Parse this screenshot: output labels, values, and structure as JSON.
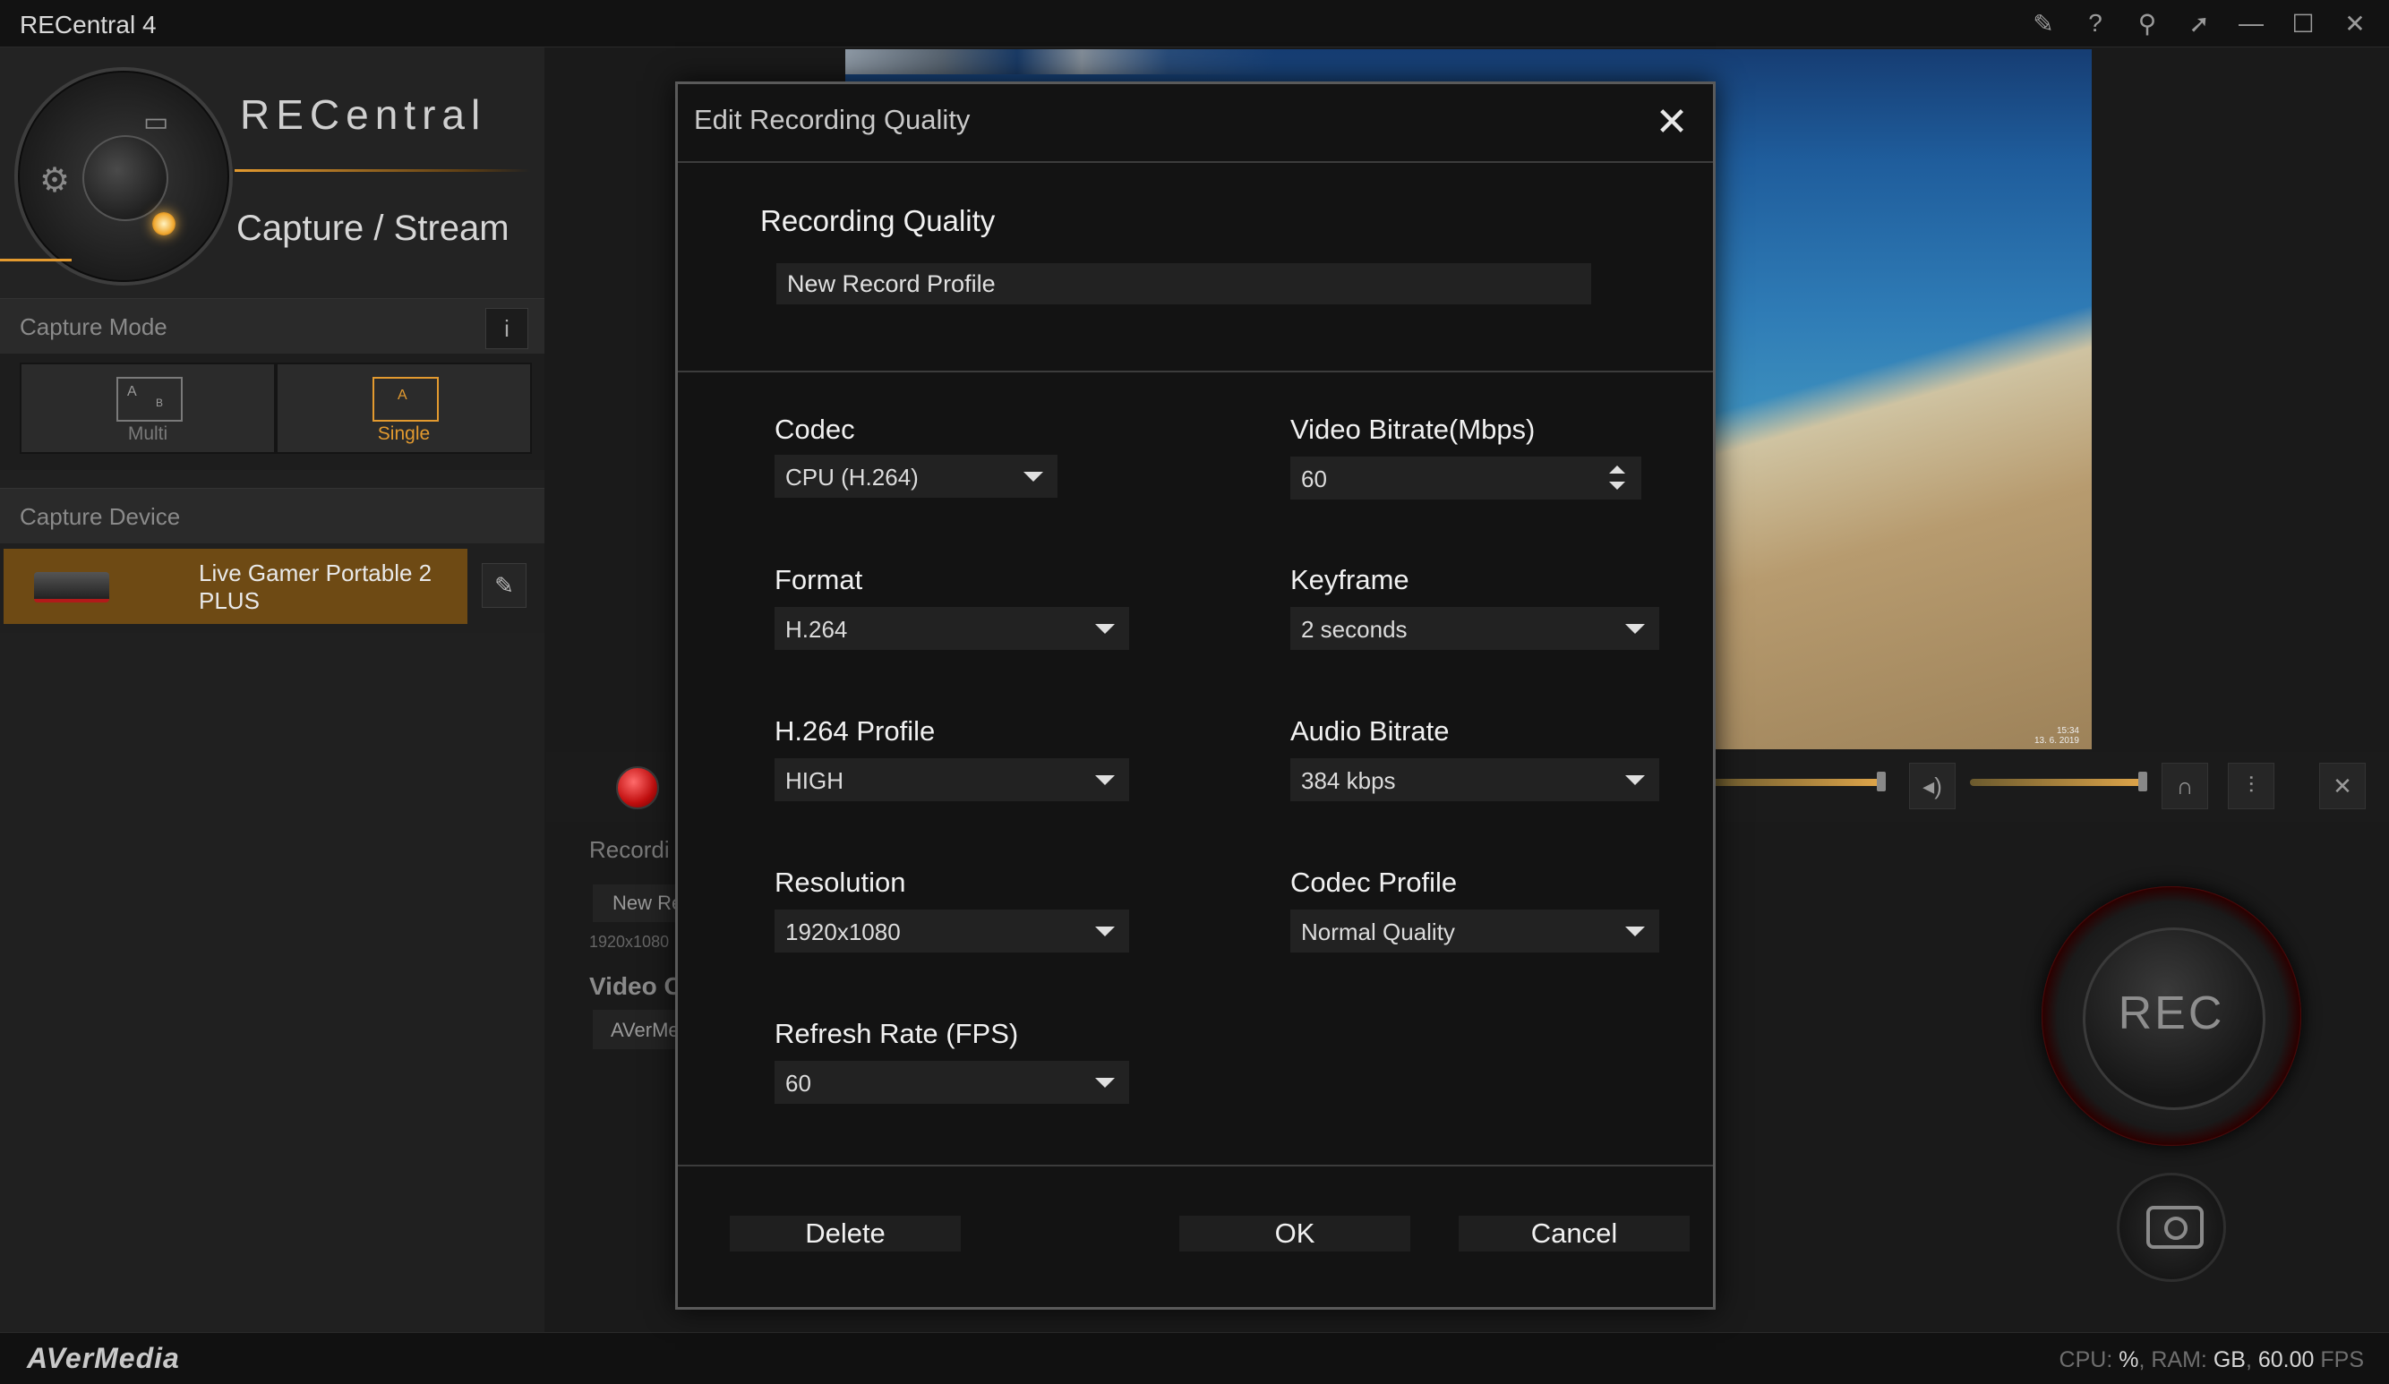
{
  "app": {
    "title": "RECentral 4",
    "brand": "RECentral",
    "subtitle": "Capture / Stream",
    "window_icons": [
      "pin-icon",
      "help-icon",
      "pin-icon",
      "pin-icon",
      "minimize-icon",
      "maximize-icon",
      "close-icon"
    ]
  },
  "sidebar": {
    "capture_mode_label": "Capture Mode",
    "info_label": "i",
    "modes": [
      {
        "label": "Multi",
        "active": false
      },
      {
        "label": "Single",
        "active": true
      }
    ],
    "capture_device_label": "Capture Device",
    "device_name": "Live Gamer Portable 2 PLUS"
  },
  "preview": {
    "timestamp_line1": "15:34",
    "timestamp_line2": "13. 6. 2019"
  },
  "background_panel": {
    "recording_label": "Recordi",
    "profile_value": "New Re",
    "resolution_value": "1920x1080",
    "video_label": "Video C",
    "device_value": "AVerMe"
  },
  "rec_button_label": "REC",
  "status_bar": {
    "logo_text": "AVerMedia",
    "cpu_label": "CPU:",
    "cpu_value": "%",
    "ram_label": ", RAM:",
    "ram_value": "GB",
    "fps_value": "60.00",
    "fps_label": "FPS"
  },
  "dialog": {
    "title": "Edit Recording Quality",
    "close_label": "✕",
    "recording_quality_label": "Recording Quality",
    "profile_name": "New Record Profile",
    "fields": {
      "codec": {
        "label": "Codec",
        "value": "CPU (H.264)"
      },
      "video_bitrate": {
        "label": "Video Bitrate(Mbps)",
        "value": "60"
      },
      "format": {
        "label": "Format",
        "value": "H.264"
      },
      "keyframe": {
        "label": "Keyframe",
        "value": "2 seconds"
      },
      "h264_profile": {
        "label": "H.264 Profile",
        "value": "HIGH"
      },
      "audio_bitrate": {
        "label": "Audio Bitrate",
        "value": "384 kbps"
      },
      "resolution": {
        "label": "Resolution",
        "value": "1920x1080"
      },
      "codec_profile": {
        "label": "Codec Profile",
        "value": "Normal Quality"
      },
      "refresh_rate": {
        "label": "Refresh Rate (FPS)",
        "value": "60"
      }
    },
    "buttons": {
      "delete": "Delete",
      "ok": "OK",
      "cancel": "Cancel"
    }
  },
  "colors": {
    "accent": "#e39a2f",
    "rec_red": "#c20f0f",
    "dialog_bg": "#131313",
    "field_bg": "#222222"
  }
}
